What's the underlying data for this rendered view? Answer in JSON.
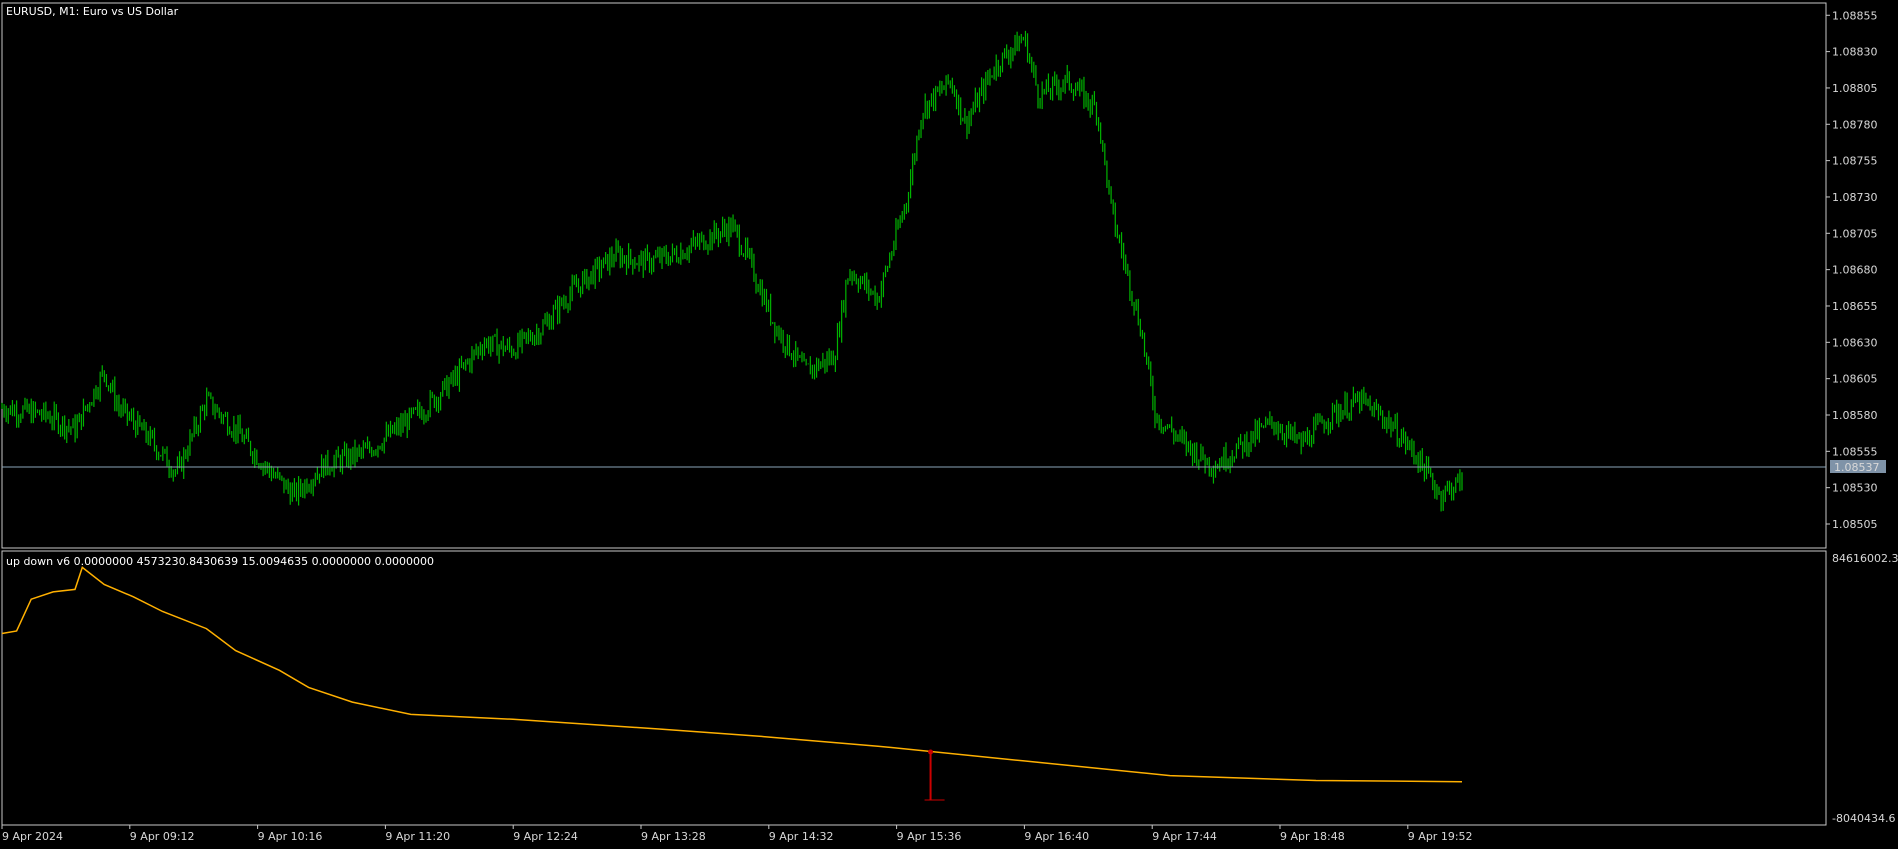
{
  "window": {
    "symbol_title": "EURUSD, M1:  Euro vs US Dollar"
  },
  "indicator": {
    "label": "up down v6 0.0000000 4573230.8430639 15.0094635 0.0000000 0.0000000"
  },
  "colors": {
    "background": "#000000",
    "candles": "#00b400",
    "grid_border": "#c8c8c8",
    "price_line": "#8aa4b8",
    "indicator_line": "#ffb000",
    "signal": "#cc0000",
    "current_price_bg": "#7f93a8"
  },
  "chart_data": [
    {
      "type": "line",
      "title": "EURUSD, M1:  Euro vs US Dollar",
      "series_kind": "price bars (OHLC)",
      "x_tick_labels": [
        "9 Apr 2024",
        "9 Apr 09:12",
        "9 Apr 10:16",
        "9 Apr 11:20",
        "9 Apr 12:24",
        "9 Apr 13:28",
        "9 Apr 14:32",
        "9 Apr 15:36",
        "9 Apr 16:40",
        "9 Apr 17:44",
        "9 Apr 18:48",
        "9 Apr 19:52"
      ],
      "y_tick_labels": [
        "1.08855",
        "1.08830",
        "1.08805",
        "1.08780",
        "1.08755",
        "1.08730",
        "1.08705",
        "1.08680",
        "1.08655",
        "1.08630",
        "1.08605",
        "1.08580",
        "1.08555",
        "1.08530",
        "1.08505"
      ],
      "ylim": [
        1.08494,
        1.0886
      ],
      "current_price": "1.08537",
      "grid": false,
      "path_points": [
        [
          0,
          1.08585
        ],
        [
          0.03,
          1.0858
        ],
        [
          0.05,
          1.0857
        ],
        [
          0.07,
          1.0861
        ],
        [
          0.08,
          1.08585
        ],
        [
          0.1,
          1.08565
        ],
        [
          0.12,
          1.0854
        ],
        [
          0.14,
          1.0859
        ],
        [
          0.16,
          1.0857
        ],
        [
          0.18,
          1.08545
        ],
        [
          0.2,
          1.08525
        ],
        [
          0.22,
          1.08545
        ],
        [
          0.25,
          1.08555
        ],
        [
          0.27,
          1.0857
        ],
        [
          0.29,
          1.08585
        ],
        [
          0.31,
          1.08605
        ],
        [
          0.33,
          1.0863
        ],
        [
          0.35,
          1.08625
        ],
        [
          0.37,
          1.0864
        ],
        [
          0.39,
          1.08665
        ],
        [
          0.42,
          1.0869
        ],
        [
          0.44,
          1.08685
        ],
        [
          0.46,
          1.0869
        ],
        [
          0.48,
          1.087
        ],
        [
          0.5,
          1.0871
        ],
        [
          0.51,
          1.0869
        ],
        [
          0.53,
          1.0864
        ],
        [
          0.55,
          1.0861
        ],
        [
          0.57,
          1.0862
        ],
        [
          0.58,
          1.0868
        ],
        [
          0.6,
          1.0866
        ],
        [
          0.62,
          1.0873
        ],
        [
          0.63,
          1.0879
        ],
        [
          0.65,
          1.0881
        ],
        [
          0.66,
          1.0878
        ],
        [
          0.68,
          1.0882
        ],
        [
          0.7,
          1.0884
        ],
        [
          0.71,
          1.088
        ],
        [
          0.73,
          1.0881
        ],
        [
          0.75,
          1.0879
        ],
        [
          0.76,
          1.0872
        ],
        [
          0.78,
          1.0864
        ],
        [
          0.79,
          1.0858
        ],
        [
          0.81,
          1.0856
        ],
        [
          0.83,
          1.08545
        ],
        [
          0.85,
          1.0856
        ],
        [
          0.87,
          1.08575
        ],
        [
          0.89,
          1.0856
        ],
        [
          0.91,
          1.0858
        ],
        [
          0.93,
          1.0859
        ],
        [
          0.95,
          1.08575
        ],
        [
          0.97,
          1.0855
        ],
        [
          0.985,
          1.08525
        ],
        [
          1,
          1.08535
        ]
      ]
    },
    {
      "type": "line",
      "title": "up down v6 0.0000000 4573230.8430639 15.0094635 0.0000000 0.0000000",
      "y_tick_labels": [
        "84616002.3",
        "-8040434.6"
      ],
      "ylim": [
        -8040434.6,
        84616002.3
      ],
      "series": [
        {
          "values_normalized": [
            [
              0,
              0.7
            ],
            [
              0.01,
              0.71
            ],
            [
              0.02,
              0.84
            ],
            [
              0.035,
              0.87
            ],
            [
              0.05,
              0.88
            ],
            [
              0.055,
              0.97
            ],
            [
              0.07,
              0.9
            ],
            [
              0.09,
              0.85
            ],
            [
              0.11,
              0.79
            ],
            [
              0.14,
              0.72
            ],
            [
              0.16,
              0.63
            ],
            [
              0.19,
              0.55
            ],
            [
              0.21,
              0.48
            ],
            [
              0.24,
              0.42
            ],
            [
              0.28,
              0.37
            ],
            [
              0.35,
              0.35
            ],
            [
              0.45,
              0.31
            ],
            [
              0.52,
              0.28
            ],
            [
              0.6,
              0.24
            ],
            [
              0.7,
              0.18
            ],
            [
              0.8,
              0.12
            ],
            [
              0.9,
              0.1
            ],
            [
              1,
              0.095
            ]
          ]
        }
      ],
      "signals": [
        {
          "x_normalized": 0.636,
          "level_normalized": 0.25,
          "color": "#cc0000"
        }
      ]
    }
  ]
}
